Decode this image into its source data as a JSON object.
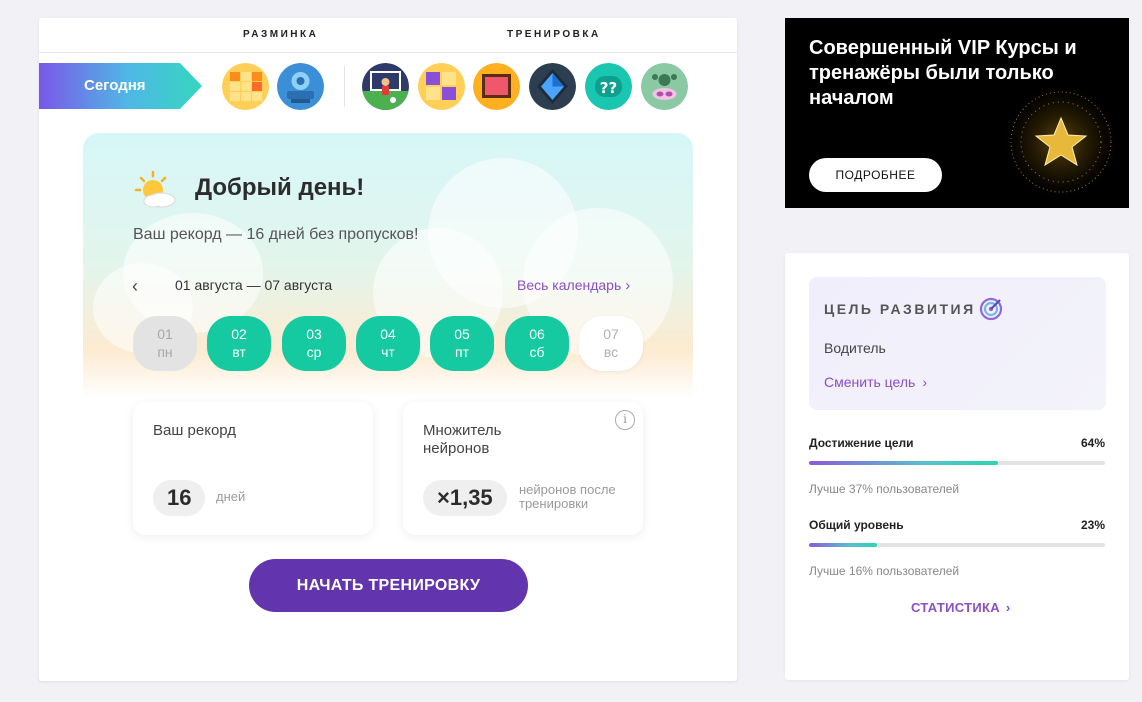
{
  "sections": {
    "warmup": "РАЗМИНКА",
    "training": "ТРЕНИРОВКА"
  },
  "today_label": "Сегодня",
  "games": {
    "warmup": [
      "grid-puzzle-game-icon",
      "robot-game-icon"
    ],
    "training": [
      "soccer-game-icon",
      "purple-tiles-game-icon",
      "picture-frame-game-icon",
      "diamond-game-icon",
      "question-marks-game-icon",
      "paw-game-icon"
    ]
  },
  "greeting": "Добрый день!",
  "record_message": "Ваш рекорд — 16 дней без пропусков!",
  "calendar": {
    "range": "01 августа — 07 августа",
    "link": "Весь календарь",
    "days": [
      {
        "num": "01",
        "name": "пн",
        "status": "past"
      },
      {
        "num": "02",
        "name": "вт",
        "status": "done"
      },
      {
        "num": "03",
        "name": "ср",
        "status": "done"
      },
      {
        "num": "04",
        "name": "чт",
        "status": "done"
      },
      {
        "num": "05",
        "name": "пт",
        "status": "done"
      },
      {
        "num": "06",
        "name": "сб",
        "status": "done"
      },
      {
        "num": "07",
        "name": "вс",
        "status": "future"
      }
    ]
  },
  "record_card": {
    "title": "Ваш рекорд",
    "value": "16",
    "unit": "дней"
  },
  "multiplier_card": {
    "title": "Множитель нейронов",
    "value": "×1,35",
    "unit": "нейронов после тренировки",
    "info": "i"
  },
  "start_button": "НАЧАТЬ ТРЕНИРОВКУ",
  "vip": {
    "title": "Совершенный VIP Курсы и тренажёры были только началом",
    "button": "ПОДРОБНЕЕ"
  },
  "goal": {
    "heading": "ЦЕЛЬ РАЗВИТИЯ",
    "name": "Водитель",
    "change": "Сменить цель"
  },
  "progress": [
    {
      "label": "Достижение цели",
      "pct": "64%",
      "value": 0.64,
      "note": "Лучше 37% пользователей"
    },
    {
      "label": "Общий уровень",
      "pct": "23%",
      "value": 0.23,
      "note": "Лучше 16% пользователей"
    }
  ],
  "stats_link": "СТАТИСТИКА",
  "colors": {
    "accent": "#8b4fc7",
    "done_day": "#15c9a0",
    "primary_button": "#6234ad"
  }
}
